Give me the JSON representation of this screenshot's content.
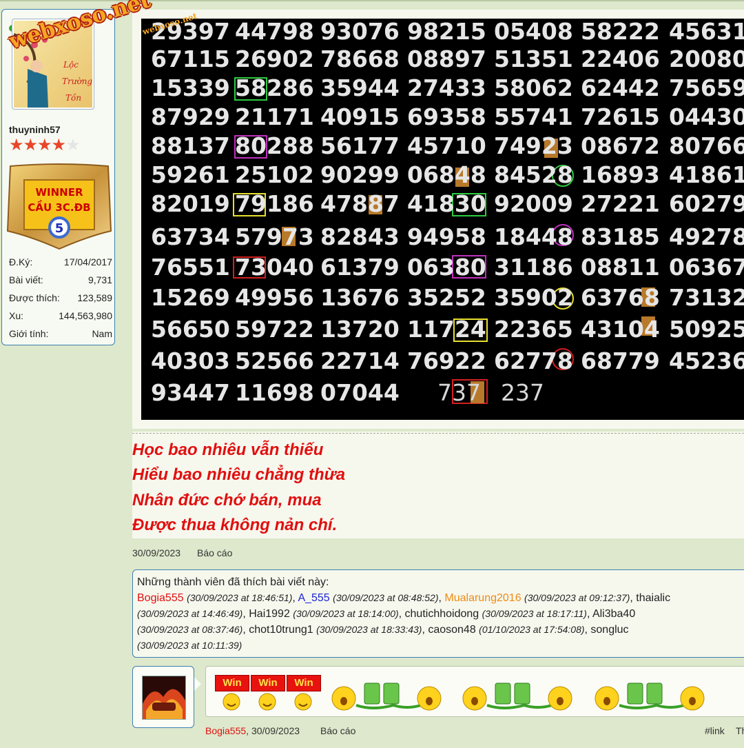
{
  "user": {
    "username": "thuyninh57",
    "logo_text": "webxoso.net",
    "stars_filled": 4,
    "stars_total": 5,
    "badge": {
      "line1": "WINNER",
      "line2": "CẦU 3C.ĐB",
      "number": "5"
    },
    "stats": [
      {
        "label": "Đ.Ký:",
        "value": "17/04/2017"
      },
      {
        "label": "Bài viết:",
        "value": "9,731"
      },
      {
        "label": "Được thích:",
        "value": "123,589"
      },
      {
        "label": "Xu:",
        "value": "144,563,980"
      },
      {
        "label": "Giới tính:",
        "value": "Nam"
      }
    ]
  },
  "lotto": {
    "watermark": "webxoso.net",
    "rows": [
      [
        "29397",
        "44798",
        "93076",
        "98215",
        "05408",
        "58222",
        "45631"
      ],
      [
        "67115",
        "26902",
        "78668",
        "08897",
        "51351",
        "22406",
        "20080"
      ],
      [
        "15339",
        "58286",
        "35944",
        "27433",
        "58062",
        "62442",
        "75659"
      ],
      [
        "87929",
        "21171",
        "40915",
        "69358",
        "55741",
        "72615",
        "04430"
      ],
      [
        "88137",
        "80288",
        "56177",
        "45710",
        "74923",
        "08672",
        "80766"
      ],
      [
        "59261",
        "25102",
        "90299",
        "06848",
        "84528",
        "16893",
        "41861"
      ],
      [
        "82019",
        "79186",
        "47887",
        "41830",
        "92009",
        "27221",
        "60279"
      ],
      [
        "63734",
        "57973",
        "82843",
        "94958",
        "18448",
        "83185",
        "49278"
      ],
      [
        "76551",
        "73040",
        "61379",
        "06380",
        "31186",
        "08811",
        "06367"
      ],
      [
        "15269",
        "49956",
        "13676",
        "35252",
        "35902",
        "63768",
        "73132"
      ],
      [
        "56650",
        "59722",
        "13720",
        "11724",
        "22365",
        "43104",
        "50925"
      ],
      [
        "40303",
        "52566",
        "22714",
        "76922",
        "62778",
        "68779",
        "45236"
      ],
      [
        "93447",
        "11698",
        "07044",
        "",
        "",
        "",
        ""
      ]
    ],
    "bottom_values": [
      "737",
      "237"
    ]
  },
  "signature": {
    "lines": [
      "Học bao nhiêu vẫn thiếu",
      "Hiểu bao nhiêu chẳng thừa",
      "Nhân đức chớ bán, mua",
      "Được thua không nản chí."
    ]
  },
  "post_meta": {
    "date": "30/09/2023",
    "report": "Báo cáo"
  },
  "likes": {
    "heading": "Những thành viên đã thích bài viết này:",
    "entries": [
      {
        "name": "Bogia555",
        "time": "(30/09/2023 at 18:46:51)",
        "color": "#e10f0f"
      },
      {
        "name": "A_555",
        "time": "(30/09/2023 at 08:48:52)",
        "color": "#1a23d6"
      },
      {
        "name": "Mualarung2016",
        "time": "(30/09/2023 at 09:12:37)",
        "color": "#ef8a14"
      },
      {
        "name": "thaialic",
        "time": "(30/09/2023 at 14:46:49)",
        "color": "#222222"
      },
      {
        "name": "Hai1992",
        "time": "(30/09/2023 at 18:14:00)",
        "color": "#222222"
      },
      {
        "name": "chutichhoidong",
        "time": "(30/09/2023 at 18:17:11)",
        "color": "#222222"
      },
      {
        "name": "Ali3ba40",
        "time": "(30/09/2023 at 08:37:46)",
        "color": "#222222"
      },
      {
        "name": "chot10trung1",
        "time": "(30/09/2023 at 18:33:43)",
        "color": "#222222"
      },
      {
        "name": "caoson48",
        "time": "(01/10/2023 at 17:54:08)",
        "color": "#222222"
      },
      {
        "name": "songluc",
        "time": "(30/09/2023 at 10:11:39)",
        "color": "#222222"
      }
    ]
  },
  "reply": {
    "win_label": "Win",
    "author": "Bogia555",
    "date": ", 30/09/2023",
    "report": "Báo cáo",
    "link": "#link",
    "extra": "Th"
  }
}
